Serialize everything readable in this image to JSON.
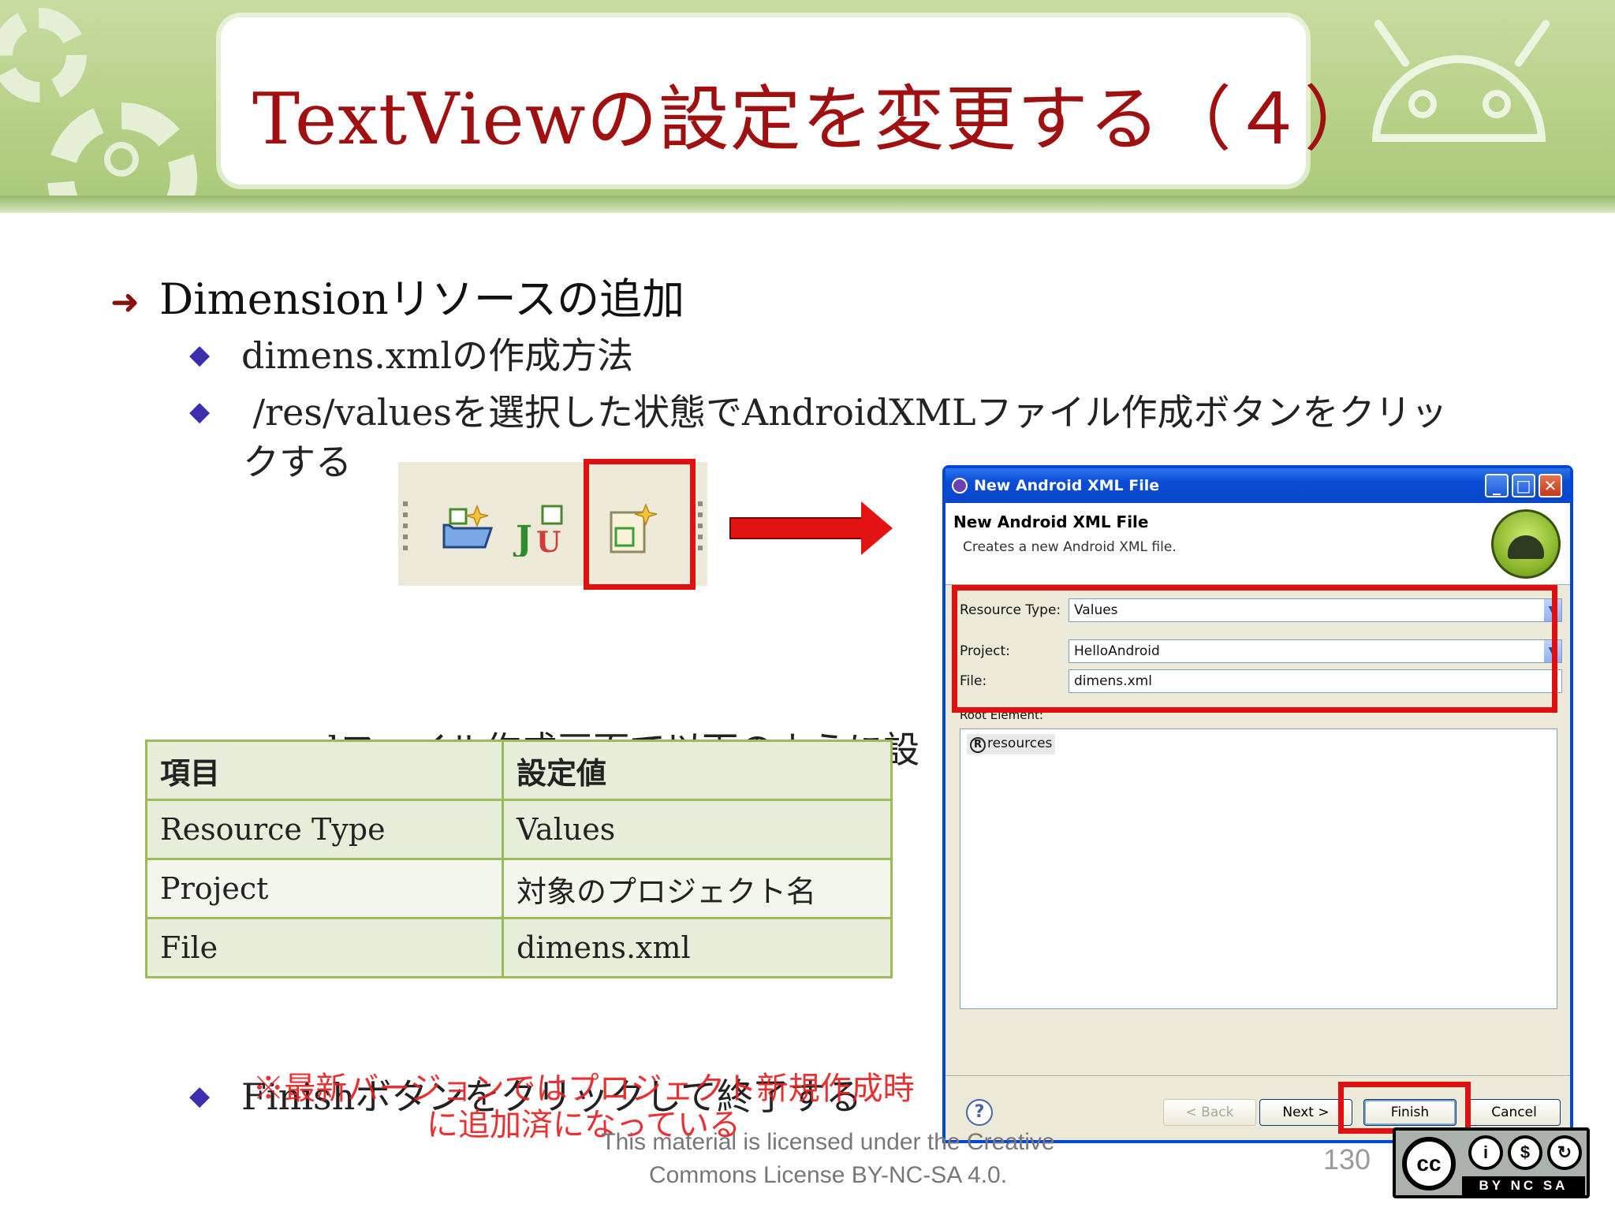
{
  "slide": {
    "title": "TextViewの設定を変更する（４）",
    "bullet1": "Dimensionリソースの追加",
    "sub1": "dimens.xmlの作成方法",
    "sub2": " /res/valuesを選択した状態でAndroidXMLファイル作成ボタンをクリッ",
    "sub2_cont": "クする",
    "sub3": "xmlファイル作成画面で以下のように設",
    "sub4": "Finishボタンをクリックして終了する",
    "note": "※最新バージョンではプロジェクト新規作成時に追加済になっている",
    "license": "This material is licensed under the Creative Commons License BY-NC-SA 4.0.",
    "page_number": "130"
  },
  "toolbar": {
    "icons": [
      "new-folder-icon",
      "new-junit-icon",
      "new-android-xml-file-icon"
    ]
  },
  "table": {
    "headers": [
      "項目",
      "設定値"
    ],
    "rows": [
      [
        "Resource Type",
        "Values"
      ],
      [
        "Project",
        "対象のプロジェクト名"
      ],
      [
        "File",
        "dimens.xml"
      ]
    ]
  },
  "dialog": {
    "window_title": "New Android XML File",
    "header": "New Android XML File",
    "description": "Creates a new Android XML file.",
    "resource_type_label": "Resource Type:",
    "resource_type_value": "Values",
    "project_label": "Project:",
    "project_value": "HelloAndroid",
    "file_label": "File:",
    "file_value": "dimens.xml",
    "root_element_label": "Root Element:",
    "root_items": [
      "resources"
    ],
    "buttons": {
      "help": "?",
      "back": "< Back",
      "next": "Next >",
      "finish": "Finish",
      "cancel": "Cancel"
    }
  },
  "cc_badge": {
    "main": "cc",
    "terms": "BY  NC  SA"
  },
  "colors": {
    "title_red": "#a01010",
    "highlight_red": "#e01010",
    "table_border": "#9bbb59",
    "xp_blue": "#0a4cd6"
  }
}
